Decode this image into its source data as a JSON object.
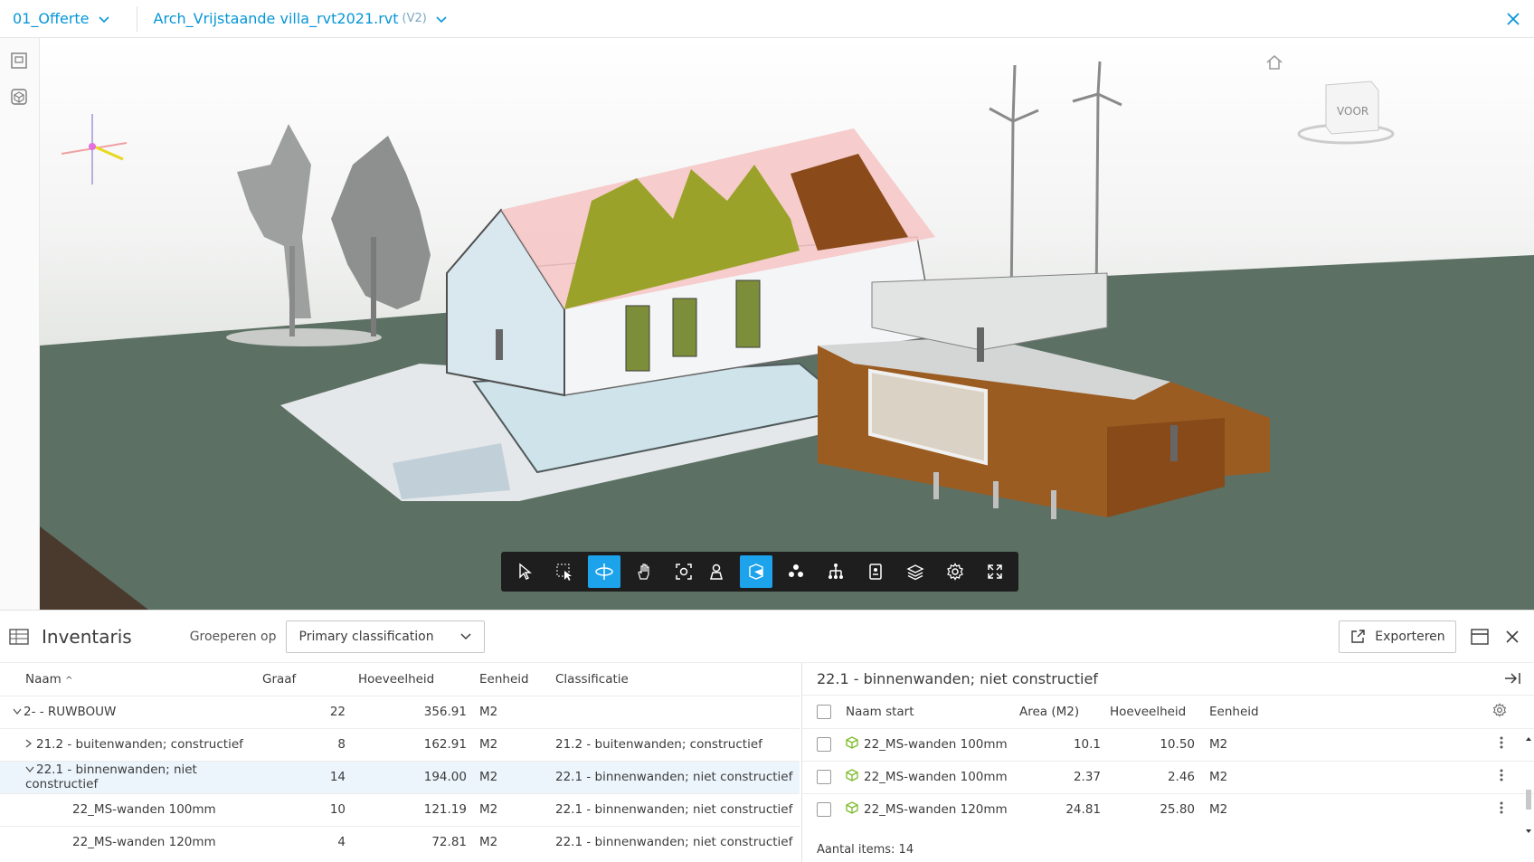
{
  "topbar": {
    "folder": "01_Offerte",
    "file": "Arch_Vrijstaande villa_rvt2021.rvt",
    "version": "(V2)"
  },
  "viewcube": {
    "face_label": "VOOR"
  },
  "toolbar": {
    "groups": [
      [
        "select-icon",
        "box-select-icon",
        "orbit-icon",
        "pan-icon",
        "fit-view-icon",
        "zoom-window-icon"
      ],
      [
        "first-person-icon",
        "section-icon",
        "explode-icon"
      ],
      [
        "model-browser-icon",
        "properties-icon",
        "layers-icon",
        "settings-icon",
        "fullscreen-icon"
      ]
    ],
    "active": [
      "orbit-icon",
      "section-icon"
    ]
  },
  "panel": {
    "title": "Inventaris",
    "group_label": "Groeperen op",
    "group_value": "Primary classification",
    "export_label": "Exporteren"
  },
  "left_table": {
    "headers": {
      "name": "Naam",
      "count": "Graaf",
      "qty": "Hoeveelheid",
      "unit": "Eenheid",
      "class": "Classificatie"
    },
    "rows": [
      {
        "indent": 0,
        "toggle": "v",
        "name": "2- - RUWBOUW",
        "count": "22",
        "qty": "356.91",
        "unit": "M2",
        "class": ""
      },
      {
        "indent": 1,
        "toggle": ">",
        "name": "21.2 - buitenwanden; constructief",
        "count": "8",
        "qty": "162.91",
        "unit": "M2",
        "class": "21.2 - buitenwanden; constructief"
      },
      {
        "indent": 1,
        "toggle": "v",
        "name": "22.1 - binnenwanden; niet constructief",
        "count": "14",
        "qty": "194.00",
        "unit": "M2",
        "class": "22.1 - binnenwanden; niet constructief"
      },
      {
        "indent": 2,
        "toggle": "",
        "name": "22_MS-wanden 100mm",
        "count": "10",
        "qty": "121.19",
        "unit": "M2",
        "class": "22.1 - binnenwanden; niet constructief"
      },
      {
        "indent": 2,
        "toggle": "",
        "name": "22_MS-wanden 120mm",
        "count": "4",
        "qty": "72.81",
        "unit": "M2",
        "class": "22.1 - binnenwanden; niet constructief"
      }
    ]
  },
  "right_table": {
    "title": "22.1 - binnenwanden; niet constructief",
    "headers": {
      "name": "Naam start",
      "area": "Area (M2)",
      "qty": "Hoeveelheid",
      "unit": "Eenheid"
    },
    "rows": [
      {
        "name": "22_MS-wanden 100mm",
        "area": "10.1",
        "qty": "10.50",
        "unit": "M2"
      },
      {
        "name": "22_MS-wanden 100mm",
        "area": "2.37",
        "qty": "2.46",
        "unit": "M2"
      },
      {
        "name": "22_MS-wanden 120mm",
        "area": "24.81",
        "qty": "25.80",
        "unit": "M2"
      }
    ],
    "footer": "Aantal items: 14"
  },
  "colors": {
    "accent": "#0696d7",
    "active_tool": "#1ca3ec",
    "element_icon": "#7dbb2c"
  }
}
